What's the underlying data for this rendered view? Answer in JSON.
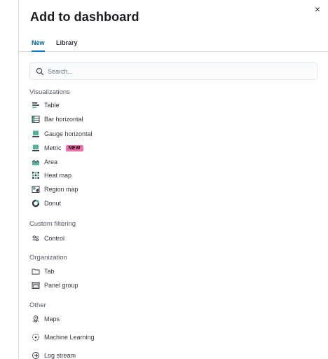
{
  "header": {
    "title": "Add to dashboard",
    "close_label": "×"
  },
  "tabs": [
    {
      "label": "New",
      "active": true
    },
    {
      "label": "Library",
      "active": false
    }
  ],
  "search": {
    "placeholder": "Search...",
    "value": ""
  },
  "sections": {
    "visualizations": {
      "title": "Visualizations",
      "items": [
        {
          "label": "Table",
          "icon": "table-icon"
        },
        {
          "label": "Bar horizontal",
          "icon": "bar-horizontal-icon"
        },
        {
          "label": "Gauge horizontal",
          "icon": "gauge-horizontal-icon"
        },
        {
          "label": "Metric",
          "icon": "metric-icon",
          "badge": "NEW"
        },
        {
          "label": "Area",
          "icon": "area-icon"
        },
        {
          "label": "Heat map",
          "icon": "heat-map-icon"
        },
        {
          "label": "Region map",
          "icon": "region-map-icon"
        },
        {
          "label": "Donut",
          "icon": "donut-icon"
        }
      ]
    },
    "custom_filtering": {
      "title": "Custom filtering",
      "items": [
        {
          "label": "Control",
          "icon": "controls-icon"
        }
      ]
    },
    "organization": {
      "title": "Organization",
      "items": [
        {
          "label": "Tab",
          "icon": "folder-icon"
        },
        {
          "label": "Panel group",
          "icon": "panel-group-icon"
        }
      ]
    },
    "other": {
      "title": "Other",
      "items": [
        {
          "label": "Maps",
          "icon": "maps-icon"
        },
        {
          "label": "Machine Learning",
          "icon": "machine-learning-icon"
        },
        {
          "label": "Log stream",
          "icon": "log-stream-icon"
        }
      ]
    }
  },
  "colors": {
    "accent": "#0077cc",
    "badge": "#f06eaa",
    "icon_teal": "#54b399",
    "icon_dark": "#343741"
  }
}
